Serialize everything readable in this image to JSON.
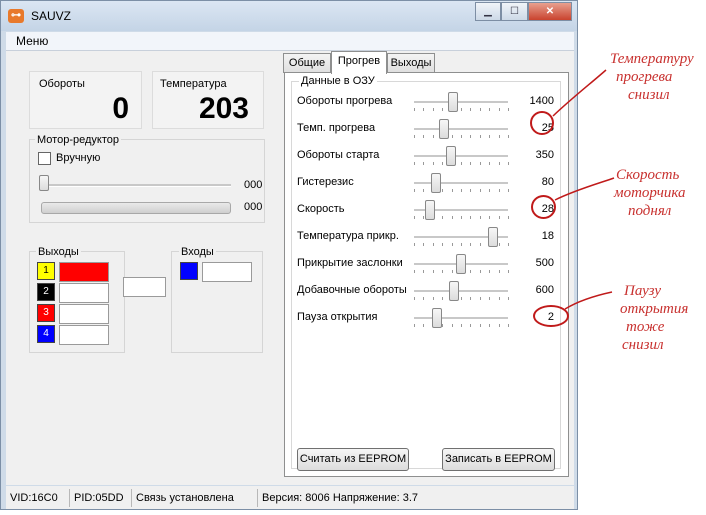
{
  "window": {
    "title": "SAUVZ",
    "icon": "app-icon",
    "accent": "#e8792b"
  },
  "menu": {
    "item": "Меню"
  },
  "left": {
    "rpm": {
      "label": "Обороты",
      "value": "0"
    },
    "temp": {
      "label": "Температура",
      "value": "203"
    },
    "motor": {
      "title": "Мотор-редуктор",
      "manual_label": "Вручную",
      "slider_value": "000",
      "progress_value": "000",
      "slider_level": 0,
      "progress_level": 0
    },
    "outputs": {
      "title": "Выходы",
      "items": [
        {
          "num": "1",
          "color": "#ffff00",
          "fill": "#ff0000"
        },
        {
          "num": "2",
          "color": "#000000",
          "fill": "#ffffff"
        },
        {
          "num": "3",
          "color": "#ff0000",
          "fill": "#ffffff"
        },
        {
          "num": "4",
          "color": "#0000ff",
          "fill": "#ffffff"
        }
      ]
    },
    "inputs": {
      "title": "Входы",
      "color": "#0000ff"
    }
  },
  "tabs": [
    "Общие",
    "Прогрев",
    "Выходы"
  ],
  "active_tab": "Прогрев",
  "ram": {
    "title": "Данные в ОЗУ",
    "rows": [
      {
        "label": "Обороты прогрева",
        "value": "1400",
        "level": 0.4
      },
      {
        "label": "Темп. прогрева",
        "value": "25",
        "level": 0.3
      },
      {
        "label": "Обороты старта",
        "value": "350",
        "level": 0.38
      },
      {
        "label": "Гистерезис",
        "value": "80",
        "level": 0.2
      },
      {
        "label": "Скорость",
        "value": "28",
        "level": 0.13
      },
      {
        "label": "Температура прикр.",
        "value": "18",
        "level": 0.88
      },
      {
        "label": "Прикрытие заслонки",
        "value": "500",
        "level": 0.5
      },
      {
        "label": "Добавочные обороты",
        "value": "600",
        "level": 0.42
      },
      {
        "label": "Пауза открытия",
        "value": "2",
        "level": 0.22
      }
    ],
    "read_button": "Считать из EEPROM",
    "write_button": "Записать в EEPROM"
  },
  "status": {
    "vid": "VID:16C0",
    "pid": "PID:05DD",
    "conn": "Связь установлена",
    "version": "Версия: 8006 Напряжение: 3.7"
  },
  "annotations": {
    "note1": [
      "Температуру",
      "прогрева",
      "снизил"
    ],
    "note2": [
      "Скорость",
      "моторчика",
      "поднял"
    ],
    "note3": [
      "Паузу",
      "открытия",
      "тоже",
      "снизил"
    ],
    "color": "#c8312f"
  }
}
